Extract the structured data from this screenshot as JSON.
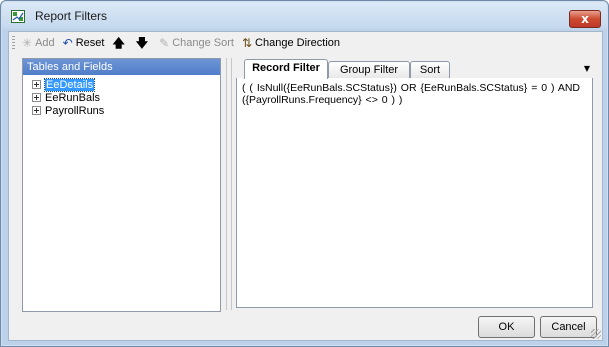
{
  "window": {
    "title": "Report Filters",
    "close_glyph": "x"
  },
  "toolbar": {
    "add_label": "Add",
    "reset_label": "Reset",
    "change_sort_label": "Change Sort",
    "change_direction_label": "Change Direction",
    "icons": {
      "add": "asterisk-icon",
      "reset": "undo-icon",
      "move_up": "arrow-up-icon",
      "move_down": "arrow-down-icon",
      "change_sort": "pencil-icon",
      "change_direction": "sort-direction-icon"
    }
  },
  "tables_panel": {
    "header": "Tables and Fields",
    "items": [
      {
        "label": "EeDetails",
        "selected": true
      },
      {
        "label": "EeRunBals",
        "selected": false
      },
      {
        "label": "PayrollRuns",
        "selected": false
      }
    ]
  },
  "tabs": [
    {
      "label": "Record Filter",
      "active": true
    },
    {
      "label": "Group Filter",
      "active": false
    },
    {
      "label": "Sort",
      "active": false
    }
  ],
  "record_filter": {
    "text": "(  (  IsNull({EeRunBals.SCStatus})  OR  {EeRunBals.SCStatus} = 0  )  AND  ({PayrollRuns.Frequency} <> 0  )  )"
  },
  "buttons": {
    "ok": "OK",
    "cancel": "Cancel"
  },
  "colors": {
    "panel_header": "#4f7ec9",
    "selection": "#3399ff",
    "close_button": "#c0392b"
  }
}
